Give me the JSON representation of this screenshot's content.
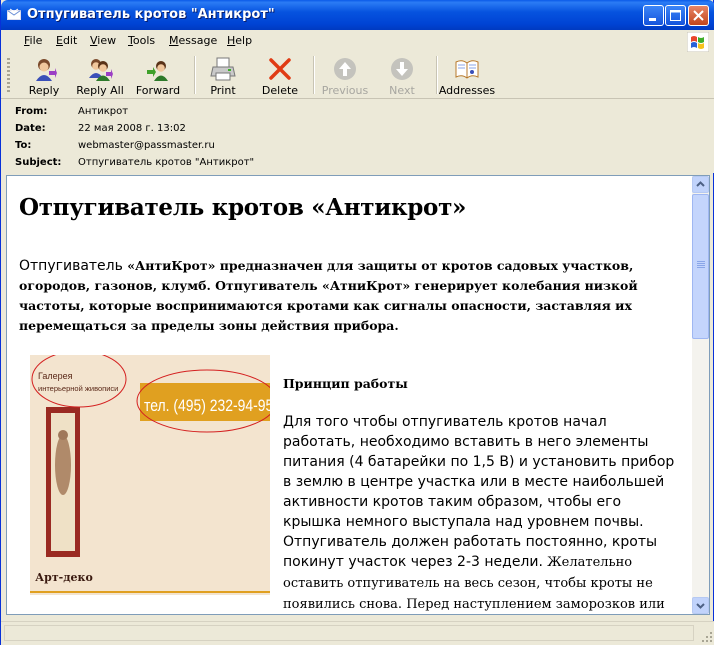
{
  "window": {
    "title": "Отпугиватель кротов \"Антикрот\""
  },
  "menu": [
    {
      "label": "File",
      "u": "F",
      "rest": "ile"
    },
    {
      "label": "Edit",
      "u": "E",
      "rest": "dit"
    },
    {
      "label": "View",
      "u": "V",
      "rest": "iew"
    },
    {
      "label": "Tools",
      "u": "T",
      "rest": "ools"
    },
    {
      "label": "Message",
      "u": "M",
      "rest": "essage"
    },
    {
      "label": "Help",
      "u": "H",
      "rest": "elp"
    }
  ],
  "toolbar": {
    "reply": "Reply",
    "reply_all": "Reply All",
    "forward": "Forward",
    "print": "Print",
    "delete": "Delete",
    "previous": "Previous",
    "next": "Next",
    "addresses": "Addresses"
  },
  "header": {
    "from_label": "From:",
    "from": "Антикрот",
    "date_label": "Date:",
    "date": "22 мая 2008 г. 13:02",
    "to_label": "To:",
    "to": "webmaster@passmaster.ru",
    "subject_label": "Subject:",
    "subject": "Отпугиватель кротов \"Антикрот\""
  },
  "message": {
    "title": "Отпугиватель кротов «Антикрот»",
    "intro_lead": "Отпугиватель",
    "intro_rest": " «АнтиКрот» предназначен для защиты от кротов садовых участков, огородов, газонов, клумб. Отпугиватель «АтниКрот» генерирует колебания низкой частоты, которые воспринимаются кротами как сигналы опасности, заставляя их перемещаться за пределы зоны действия прибора.",
    "image": {
      "gallery_line1": "Галерея",
      "gallery_line2": "интерьерной живописи",
      "phone": "тел. (495) 232-94-95",
      "signature": "Арт-деко"
    },
    "principle_title": "Принцип работы",
    "principle_text_sans": "Для того чтобы отпугиватель кротов начал работать, необходимо вставить в него элементы питания (4 батарейки по 1,5 В) и установить прибор в землю в центре участка или в месте наибольшей активности кротов таким образом, чтобы его крышка немного выступала над уровнем почвы. Отпугиватель должен работать постоянно, кроты покинут участок через 2-3 недели.",
    "principle_text_serif": " Желательно оставить отпугиватель на весь сезон, чтобы кроты не появились снова. Перед наступлением заморозков или"
  },
  "colors": {
    "titlebar": "#0653df",
    "phone_band": "#e0a020",
    "annotation_circle": "#d42020"
  }
}
